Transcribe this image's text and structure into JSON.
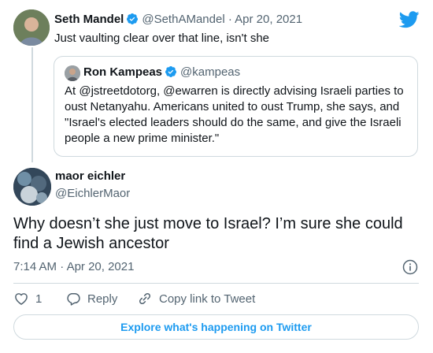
{
  "parent_tweet": {
    "name": "Seth Mandel",
    "handle": "@SethAMandel",
    "date": "Apr 20, 2021",
    "separator": "·",
    "text": "Just vaulting clear over that line, isn't she"
  },
  "quoted_tweet": {
    "name": "Ron Kampeas",
    "handle": "@kampeas",
    "text": "At @jstreetdotorg, @ewarren is directly advising Israeli parties to oust Netanyahu. Americans united to oust Trump, she says, and \"Israel's elected leaders should do the same, and give the Israeli people a new prime minister.\""
  },
  "main_tweet": {
    "name": "maor eichler",
    "handle": "@EichlerMaor",
    "text": "Why doesn’t she just move to Israel? I’m sure she could find a Jewish ancestor",
    "time": "7:14 AM",
    "separator": "·",
    "date": "Apr 20, 2021"
  },
  "actions": {
    "like_count": "1",
    "reply_label": "Reply",
    "copy_link_label": "Copy link to Tweet"
  },
  "footer": {
    "explore_label": "Explore what's happening on Twitter"
  },
  "icons": {
    "brand": "twitter-bird-icon",
    "verified": "verified-badge-icon",
    "like": "heart-icon",
    "reply": "reply-bubble-icon",
    "copy_link": "link-icon",
    "info": "info-icon"
  },
  "colors": {
    "accent": "#1d9bf0",
    "text": "#0f1419",
    "muted": "#536471",
    "border": "#cfd9de"
  }
}
